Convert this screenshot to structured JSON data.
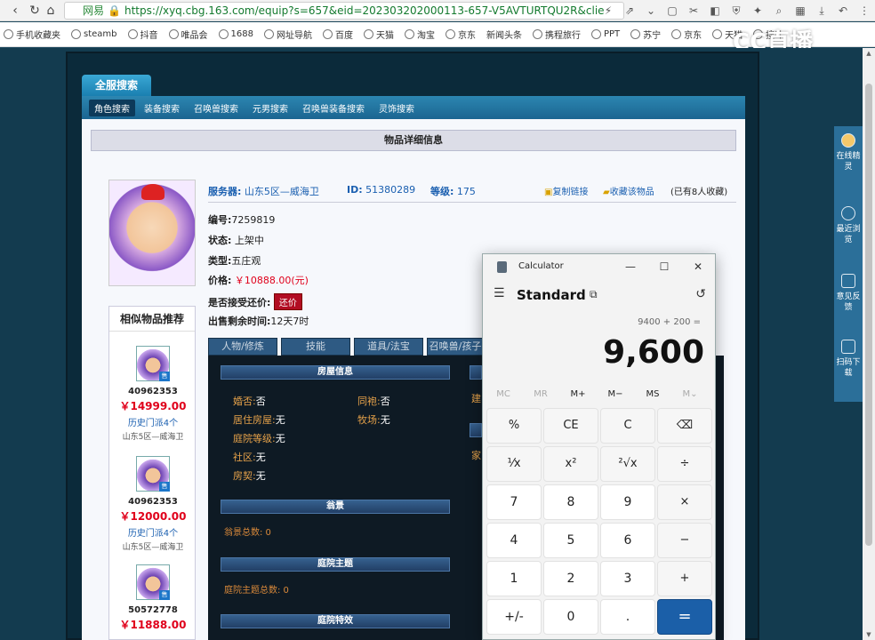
{
  "browser": {
    "site_label": "网易",
    "url": "https://xyq.cbg.163.com/equip?s=657&eid=202303202000113-657-V5AVTURTQU2R&clie",
    "bookmarks": [
      "手机收藏夹",
      "steamb",
      "抖音",
      "唯品会",
      "1688",
      "网址导航",
      "百度",
      "天猫",
      "淘宝",
      "京东",
      "新闻头条",
      "携程旅行",
      "PPT",
      "苏宁",
      "京东",
      "天猫",
      "搜叶"
    ],
    "overlay_logo": "CC直播"
  },
  "site": {
    "top_tab": "全服搜索",
    "sub_nav": [
      "角色搜索",
      "装备搜索",
      "召唤兽搜索",
      "元男搜索",
      "召唤兽装备搜索",
      "灵饰搜索"
    ],
    "detail_title": "物品详细信息",
    "info_bar": {
      "server_label": "服务器:",
      "server_value": "山东5区—威海卫",
      "id_label": "ID:",
      "id_value": "51380289",
      "level_label": "等级:",
      "level_value": "175",
      "copy_link": "复制链接",
      "favorite": "收藏该物品",
      "favorite_count": "(已有8人收藏)"
    },
    "details": {
      "code_label": "编号:",
      "code_value": "7259819",
      "status_label": "状态:",
      "status_value": "上架中",
      "type_label": "类型:",
      "type_value": "五庄观",
      "price_label": "价格:",
      "price_value": "￥10888.00(元)",
      "haggle_label": "是否接受还价:",
      "haggle_button": "还价",
      "remain_label": "出售剩余时间:",
      "remain_value": "12天7时"
    },
    "similar": {
      "title": "相似物品推荐",
      "tag": "售",
      "items": [
        {
          "id": "40962353",
          "price": "￥14999.00",
          "history": "历史门派4个",
          "server": "山东5区—威海卫"
        },
        {
          "id": "40962353",
          "price": "￥12000.00",
          "history": "历史门派4个",
          "server": "山东5区—威海卫"
        },
        {
          "id": "50572778",
          "price": "￥11888.00",
          "history": "",
          "server": ""
        }
      ]
    },
    "inner_tabs": [
      "人物/修炼",
      "技能",
      "道具/法宝",
      "召唤兽/孩子"
    ],
    "sections": {
      "house_title": "房屋信息",
      "married_label": "婚否:",
      "married_value": "否",
      "sworn_label": "同袍:",
      "sworn_value": "否",
      "house_label": "居住房屋:",
      "house_value": "无",
      "ranch_label": "牧场:",
      "ranch_value": "无",
      "yard_label": "庭院等级:",
      "yard_value": "无",
      "community_label": "社区:",
      "community_value": "无",
      "deed_label": "房契:",
      "deed_value": "无",
      "side_label_1": "建",
      "side_label_2": "家",
      "scenery_title": "翁景",
      "scenery_total": "翁景总数: 0",
      "yard_theme_title": "庭院主题",
      "yard_theme_total": "庭院主题总数: 0",
      "yard_effect_title": "庭院特效"
    }
  },
  "right_bar": [
    {
      "label": "在线精灵"
    },
    {
      "label": "最近浏览"
    },
    {
      "label": "意见反馈"
    },
    {
      "label": "扫码下载"
    }
  ],
  "calculator": {
    "title": "Calculator",
    "mode": "Standard",
    "expression": "9400 + 200 =",
    "result": "9,600",
    "memory": [
      "MC",
      "MR",
      "M+",
      "M−",
      "MS",
      "M⌄"
    ],
    "keys": [
      [
        "%",
        "CE",
        "C",
        "⌫"
      ],
      [
        "¹⁄x",
        "x²",
        "²√x",
        "÷"
      ],
      [
        "7",
        "8",
        "9",
        "×"
      ],
      [
        "4",
        "5",
        "6",
        "−"
      ],
      [
        "1",
        "2",
        "3",
        "+"
      ],
      [
        "+/-",
        "0",
        ".",
        "="
      ]
    ]
  }
}
